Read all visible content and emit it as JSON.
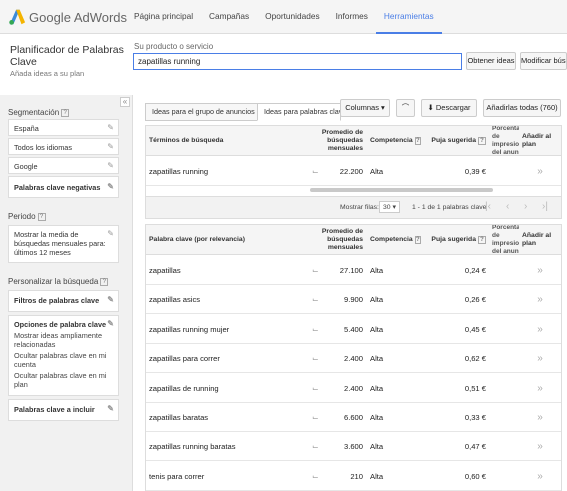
{
  "app": {
    "logo_text": "Google AdWords",
    "logo_icon": "adwords-logo-icon"
  },
  "nav": {
    "items": [
      "Página principal",
      "Campañas",
      "Oportunidades",
      "Informes",
      "Herramientas"
    ],
    "active": "Herramientas"
  },
  "header": {
    "title": "Planificador de Palabras Clave",
    "subtitle": "Añada ideas a su plan"
  },
  "product": {
    "label": "Su producto o servicio",
    "value": "zapatillas running"
  },
  "buttons": {
    "get_ideas": "Obtener ideas",
    "modify": "Modificar búsq"
  },
  "sidebar": {
    "segmentation_title": "Segmentación",
    "segmentation": [
      "España",
      "Todos los idiomas",
      "Google",
      "Palabras clave negativas"
    ],
    "period_title": "Periodo",
    "period_text": "Mostrar la media de búsquedas mensuales para: últimos 12 meses",
    "customize_title": "Personalizar la búsqueda",
    "filters": "Filtros de palabras clave",
    "options_title": "Opciones de palabra clave",
    "options": [
      "Mostrar ideas ampliamente relacionadas",
      "Ocultar palabras clave en mi cuenta",
      "Ocultar palabras clave en mi plan"
    ],
    "include": "Palabras clave a incluir"
  },
  "tabs": {
    "group_ideas": "Ideas para el grupo de anuncios",
    "keyword_ideas": "Ideas para palabras clave",
    "columns": "Columnas",
    "download": "Descargar",
    "add_all": "Añadirlas todas (760)"
  },
  "search_table": {
    "headers": {
      "term": "Términos de búsqueda",
      "avg": "Promedio de búsquedas mensuales",
      "comp": "Competencia",
      "bid": "Puja sugerida",
      "share": "Porcentaje de impresiones del anunc",
      "add": "Añadir al plan"
    },
    "rows": [
      {
        "term": "zapatillas running",
        "avg": "22.200",
        "comp": "Alta",
        "bid": "0,39 €"
      }
    ]
  },
  "pager": {
    "show_rows_label": "Mostrar filas:",
    "rows_value": "30",
    "range": "1 - 1 de 1 palabras clave"
  },
  "keyword_table": {
    "headers": {
      "term": "Palabra clave (por relevancia)",
      "avg": "Promedio de búsquedas mensuales",
      "comp": "Competencia",
      "bid": "Puja sugerida",
      "share": "Porcentaje de impresiones del anunc",
      "add": "Añadir al plan"
    },
    "rows": [
      {
        "term": "zapatillas",
        "avg": "27.100",
        "comp": "Alta",
        "bid": "0,24 €"
      },
      {
        "term": "zapatillas asics",
        "avg": "9.900",
        "comp": "Alta",
        "bid": "0,26 €"
      },
      {
        "term": "zapatillas running mujer",
        "avg": "5.400",
        "comp": "Alta",
        "bid": "0,45 €"
      },
      {
        "term": "zapatillas para correr",
        "avg": "2.400",
        "comp": "Alta",
        "bid": "0,62 €"
      },
      {
        "term": "zapatillas de running",
        "avg": "2.400",
        "comp": "Alta",
        "bid": "0,51 €"
      },
      {
        "term": "zapatillas baratas",
        "avg": "6.600",
        "comp": "Alta",
        "bid": "0,33 €"
      },
      {
        "term": "zapatillas running baratas",
        "avg": "3.600",
        "comp": "Alta",
        "bid": "0,47 €"
      },
      {
        "term": "tenis para correr",
        "avg": "210",
        "comp": "Alta",
        "bid": "0,60 €"
      }
    ]
  },
  "icons": {
    "help": "?",
    "edit": "pencil-icon",
    "trend": "trend-chart-icon",
    "add": "add-arrow-icon"
  },
  "colors": {
    "accent": "#4a7ee6"
  }
}
